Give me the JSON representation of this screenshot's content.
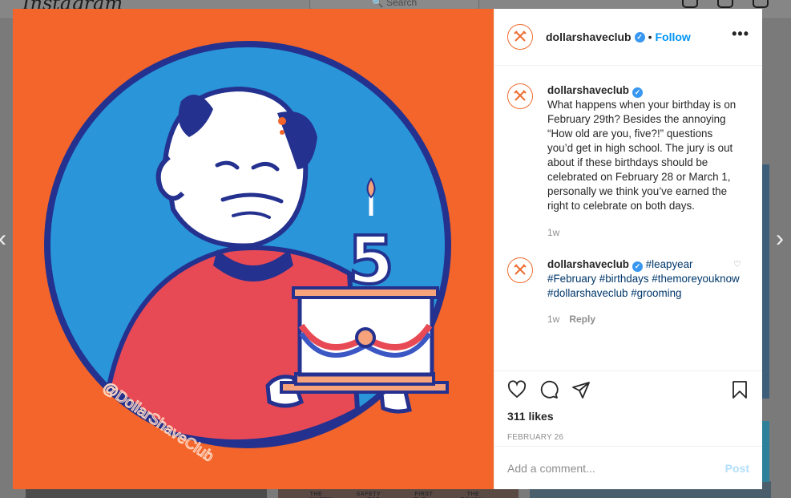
{
  "background": {
    "logo": "Instagram",
    "search_placeholder": "Search",
    "thumb_text": "THE SAFETY FIRST THE MUFFIN TOP THE ROUGH RIDER"
  },
  "image": {
    "watermark": "@DollarShaveClub",
    "candle_number": "5",
    "colors": {
      "background": "#f3652a",
      "circle": "#2a96d9",
      "outline": "#24318f"
    }
  },
  "header": {
    "username": "dollarshaveclub",
    "separator": "•",
    "follow": "Follow",
    "more": "•••"
  },
  "caption": {
    "username": "dollarshaveclub",
    "text": "What happens when your birthday is on February 29th? Besides the annoying “How old are you, five?!” questions you’d get in high school. The jury is out about if these birthdays should be celebrated on February 28 or March 1, personally we think you’ve earned the right to celebrate on both days.",
    "time": "1w"
  },
  "comment": {
    "username": "dollarshaveclub",
    "hashtags": [
      "#leapyear",
      "#February",
      "#birthdays",
      "#themoreyouknow",
      "#dollarshaveclub",
      "#grooming"
    ],
    "time": "1w",
    "reply": "Reply"
  },
  "actions": {
    "likes": "311 likes",
    "date": "FEBRUARY 26"
  },
  "add_comment": {
    "placeholder": "Add a comment...",
    "post": "Post"
  },
  "icons": {
    "verified": "verified-check-icon",
    "like": "heart-icon",
    "comment": "comment-bubble-icon",
    "share": "paper-plane-icon",
    "save": "bookmark-icon"
  },
  "colors": {
    "accent": "#0095f6",
    "brand_orange": "#ee6d2f",
    "hashtag": "#00376b"
  }
}
